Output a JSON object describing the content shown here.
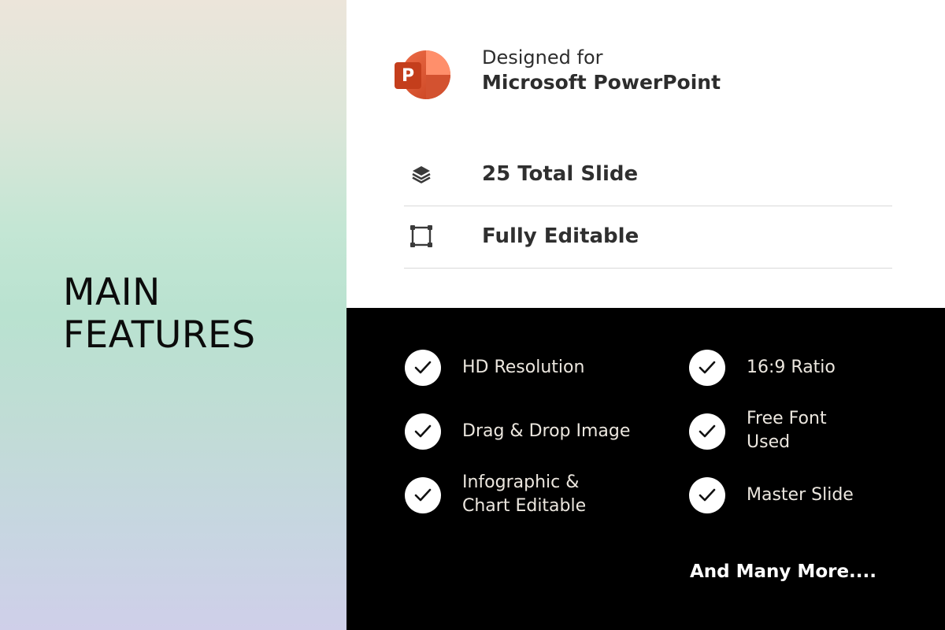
{
  "title": {
    "line1": "MAIN",
    "line2": "FEATURES"
  },
  "designed": {
    "line1": "Designed for",
    "line2": "Microsoft PowerPoint",
    "logo_letter": "P"
  },
  "specs": [
    {
      "icon": "layers-icon",
      "label": "25 Total Slide"
    },
    {
      "icon": "resize-frame-icon",
      "label": "Fully Editable"
    }
  ],
  "features": {
    "left": [
      {
        "lines": [
          "HD Resolution"
        ]
      },
      {
        "lines": [
          "Drag & Drop Image"
        ]
      },
      {
        "lines": [
          "Infographic &",
          "Chart Editable"
        ]
      }
    ],
    "right": [
      {
        "lines": [
          "16:9 Ratio"
        ]
      },
      {
        "lines": [
          "Free Font",
          "Used"
        ]
      },
      {
        "lines": [
          "Master Slide"
        ]
      }
    ]
  },
  "more": "And Many More....",
  "colors": {
    "accent": "#d35230",
    "text_dark": "#2d2d2d",
    "bg_black": "#000000"
  }
}
